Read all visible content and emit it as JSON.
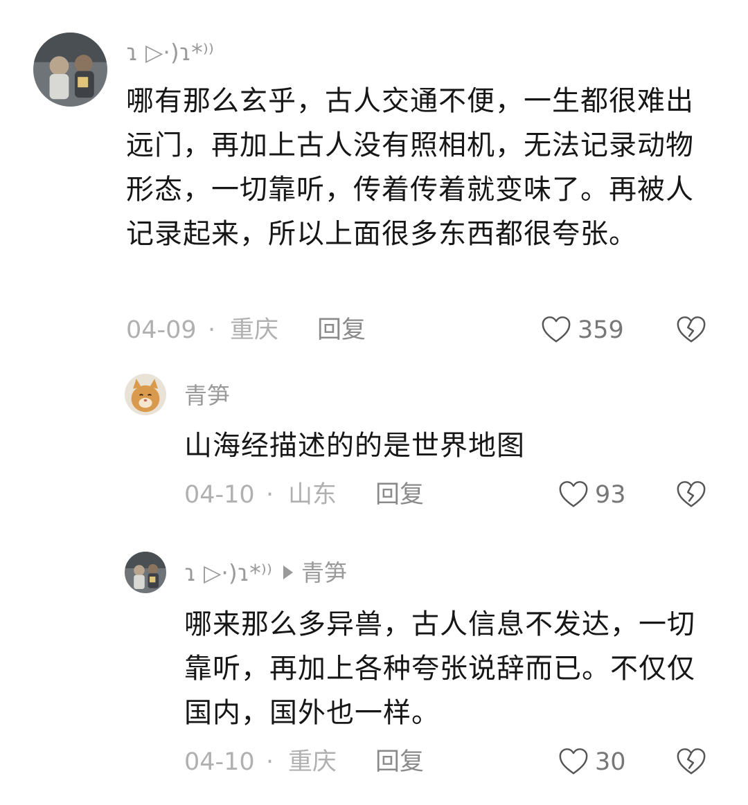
{
  "comments": [
    {
      "username": "ɿ ▷·)ɿ*⁾⁾",
      "text": "哪有那么玄乎，古人交通不便，一生都很难出远门，再加上古人没有照相机，无法记录动物形态，一切靠听，传着传着就变味了。再被人记录起来，所以上面很多东西都很夸张。",
      "date": "04-09",
      "dot": "·",
      "location": "重庆",
      "reply_label": "回复",
      "likes": "359"
    },
    {
      "username": "青笋",
      "text": "山海经描述的的是世界地图",
      "date": "04-10",
      "dot": "·",
      "location": "山东",
      "reply_label": "回复",
      "likes": "93"
    },
    {
      "username": "ɿ ▷·)ɿ*⁾⁾",
      "reply_to": "青笋",
      "text": "哪来那么多异兽，古人信息不发达，一切靠听，再加上各种夸张说辞而已。不仅仅国内，国外也一样。",
      "date": "04-10",
      "dot": "·",
      "location": "重庆",
      "reply_label": "回复",
      "likes": "30"
    }
  ],
  "icons": {
    "like": "heart-outline-icon",
    "dislike": "broken-heart-icon",
    "reply_arrow": "triangle-right-icon"
  },
  "colors": {
    "text": "#161616",
    "muted": "#b0b0b0",
    "username": "#9a9a9a",
    "icon": "#555555"
  }
}
